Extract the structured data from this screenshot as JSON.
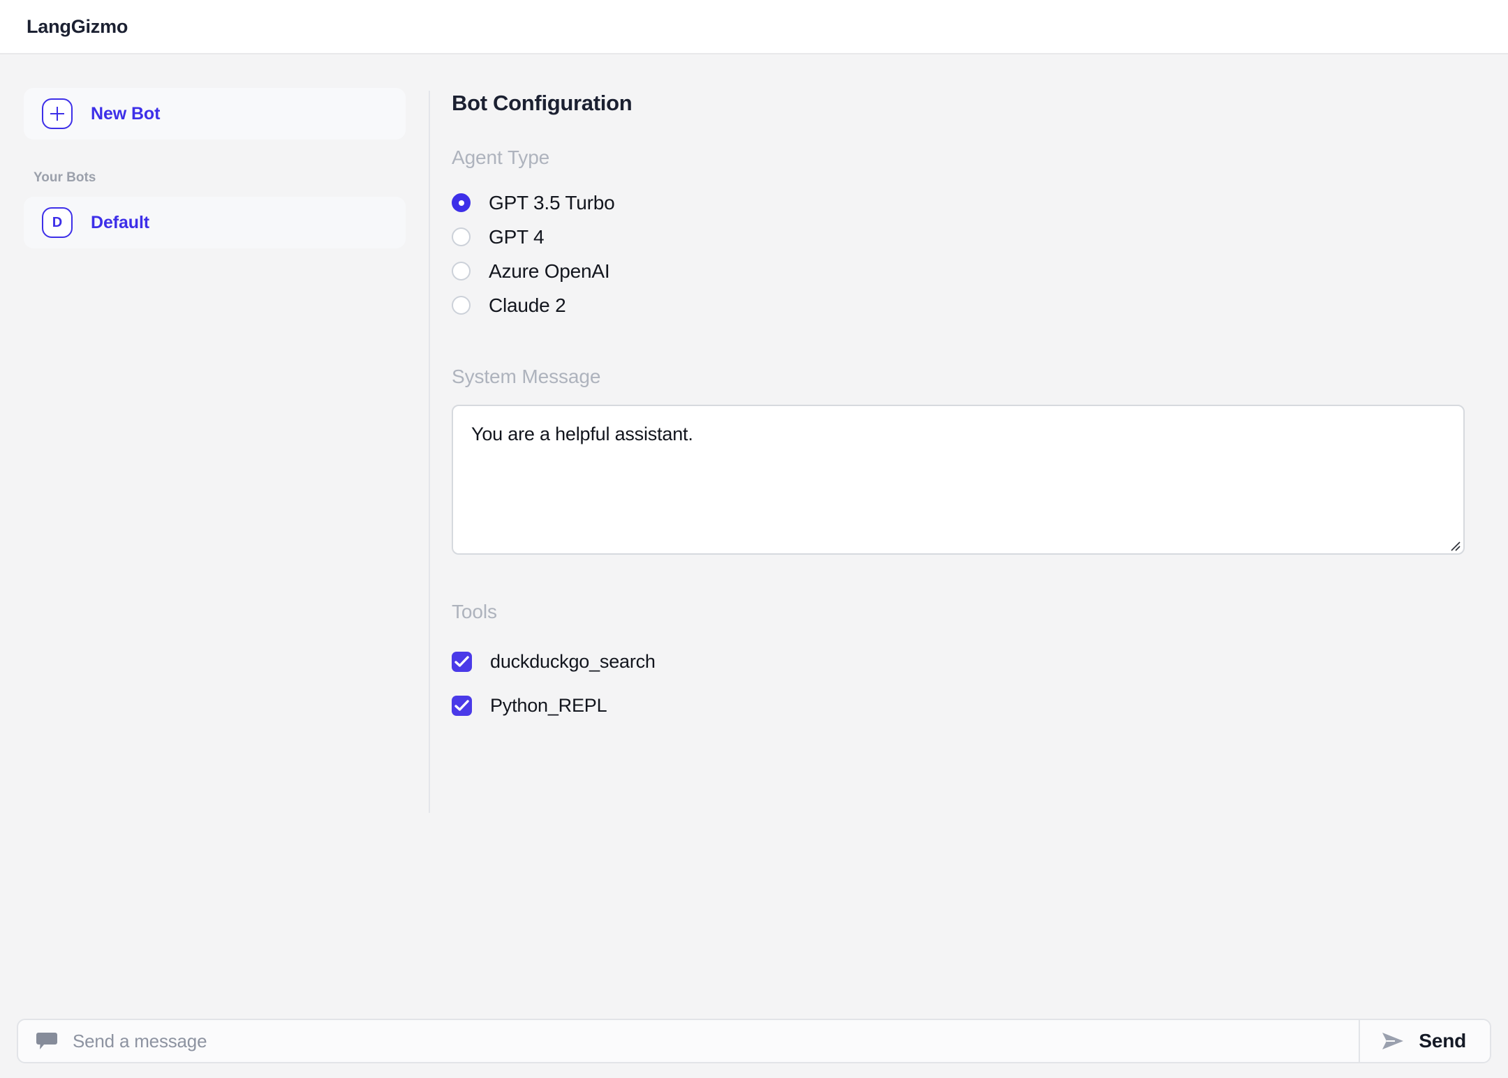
{
  "header": {
    "brand": "LangGizmo"
  },
  "colors": {
    "accent": "#3d2fe8",
    "checkbox_fill": "#4a3ae8",
    "app_background": "#f4f4f5",
    "panel_background": "#ffffff",
    "label_muted": "#aeb3bd",
    "text_primary": "#12151d"
  },
  "sidebar": {
    "new_bot": {
      "label": "New Bot",
      "icon": "plus-icon"
    },
    "section_label": "Your Bots",
    "bots": [
      {
        "label": "Default",
        "avatar_letter": "D",
        "selected": true
      }
    ]
  },
  "main": {
    "title": "Bot Configuration",
    "agent_type": {
      "label": "Agent Type",
      "options": [
        {
          "label": "GPT 3.5 Turbo",
          "checked": true
        },
        {
          "label": "GPT 4",
          "checked": false
        },
        {
          "label": "Azure OpenAI",
          "checked": false
        },
        {
          "label": "Claude 2",
          "checked": false
        }
      ]
    },
    "system_message": {
      "label": "System Message",
      "value": "You are a helpful assistant.",
      "placeholder": ""
    },
    "tools": {
      "label": "Tools",
      "items": [
        {
          "label": "duckduckgo_search",
          "checked": true
        },
        {
          "label": "Python_REPL",
          "checked": true
        }
      ]
    }
  },
  "composer": {
    "placeholder": "Send a message",
    "value": "",
    "bubble_icon": "chat-bubble-icon",
    "send_label": "Send",
    "send_icon": "send-arrow-icon"
  }
}
